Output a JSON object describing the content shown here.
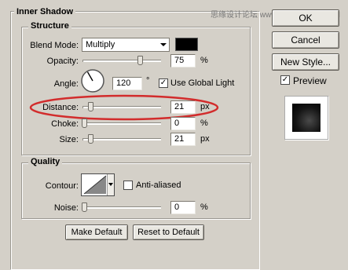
{
  "dialog": {
    "title": "Inner Shadow"
  },
  "watermark": "思缘设计论坛  www.MISSYUAN.COM",
  "structure": {
    "title": "Structure",
    "blend_mode": {
      "label": "Blend Mode:",
      "value": "Multiply"
    },
    "color_swatch": "#000000",
    "opacity": {
      "label": "Opacity:",
      "value": "75",
      "unit": "%",
      "level": 0.75
    },
    "angle": {
      "label": "Angle:",
      "value": "120",
      "unit": "°",
      "degrees": 120
    },
    "use_global_light": {
      "label": "Use Global Light",
      "checked": true
    },
    "distance": {
      "label": "Distance:",
      "value": "21",
      "unit": "px",
      "level": 0.08
    },
    "choke": {
      "label": "Choke:",
      "value": "0",
      "unit": "%",
      "level": 0.0
    },
    "size": {
      "label": "Size:",
      "value": "21",
      "unit": "px",
      "level": 0.08
    }
  },
  "quality": {
    "title": "Quality",
    "contour": {
      "label": "Contour:"
    },
    "anti_aliased": {
      "label": "Anti-aliased",
      "checked": false
    },
    "noise": {
      "label": "Noise:",
      "value": "0",
      "unit": "%",
      "level": 0.0
    }
  },
  "buttons": {
    "make_default": "Make Default",
    "reset_default": "Reset to Default",
    "ok": "OK",
    "cancel": "Cancel",
    "new_style": "New Style...",
    "preview": {
      "label": "Preview",
      "checked": true
    }
  },
  "highlight_color": "#d22c2c"
}
